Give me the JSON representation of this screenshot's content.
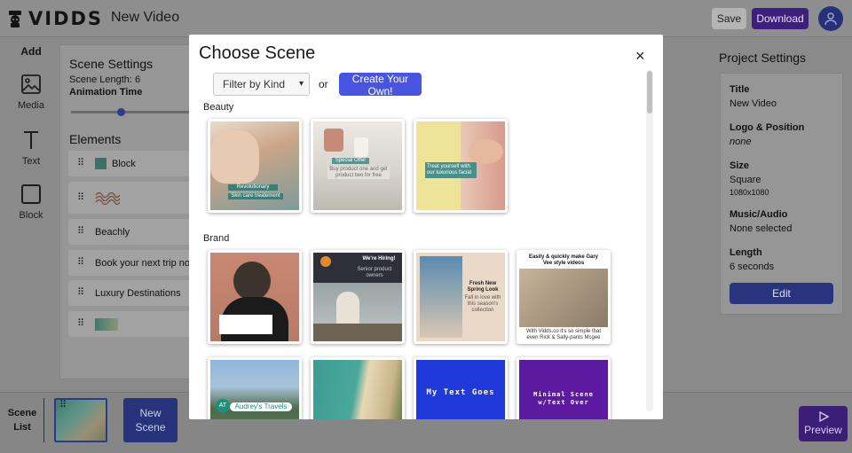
{
  "app": {
    "brand": "VIDDS",
    "document_title": "New Video",
    "save_label": "Save",
    "download_label": "Download"
  },
  "left_tools": {
    "add_label": "Add",
    "items": [
      {
        "label": "Media",
        "icon": "image-icon"
      },
      {
        "label": "Text",
        "icon": "text-t-icon"
      },
      {
        "label": "Block",
        "icon": "square-icon"
      }
    ]
  },
  "scene_settings": {
    "title": "Scene Settings",
    "scene_length": "Scene Length: 6",
    "animation_time": "Animation Time",
    "elements_title": "Elements",
    "elements": [
      {
        "label": "Block",
        "kind": "block"
      },
      {
        "label": "",
        "kind": "squiggle"
      },
      {
        "label": "Beachly",
        "kind": "text"
      },
      {
        "label": "Book your next trip now",
        "kind": "text"
      },
      {
        "label": "Luxury Destinations",
        "kind": "text"
      },
      {
        "label": "",
        "kind": "image"
      }
    ]
  },
  "modal": {
    "title": "Choose Scene",
    "close": "×",
    "filter_placeholder": "Filter by Kind",
    "or_text": "or",
    "create_label": "Create Your Own!",
    "categories": [
      {
        "name": "Beauty",
        "tiles": [
          {
            "caption_1": "Revolutionary",
            "caption_2": "Skin care treatement"
          },
          {
            "caption_1": "Special Offer",
            "caption_2": "Buy product one and get product two for free"
          },
          {
            "caption_1": "Treat yourself with our luxurious facial",
            "caption_2": ""
          }
        ]
      },
      {
        "name": "Brand",
        "tiles": [
          {
            "caption_1": "",
            "caption_2": ""
          },
          {
            "caption_1": "We're Hiring!",
            "caption_2": "Senior product owners"
          },
          {
            "caption_1": "Fresh New Spring Look",
            "caption_2": "Fall in love with this season's collection"
          },
          {
            "caption_1": "Easily & quickly make Gary Vee style videos",
            "caption_2": "With Vidds.co it's so simple that even Rick & Sally-pants Mcgee can do it!"
          }
        ]
      },
      {
        "name": "",
        "tiles": [
          {
            "caption_1": "Audrey's Travels",
            "caption_2": "AT"
          },
          {
            "caption_1": "",
            "caption_2": ""
          },
          {
            "caption_1": "My Text Goes",
            "caption_2": ""
          },
          {
            "caption_1": "Minimal Scene w/Text Over",
            "caption_2": ""
          }
        ]
      }
    ]
  },
  "project_settings": {
    "title": "Project Settings",
    "fields": [
      {
        "key": "Title",
        "value": "New Video"
      },
      {
        "key": "Logo & Position",
        "value": "none"
      },
      {
        "key": "Size",
        "value": "Square",
        "sub": "1080x1080"
      },
      {
        "key": "Music/Audio",
        "value": "None selected"
      },
      {
        "key": "Length",
        "value": "6 seconds"
      }
    ],
    "edit_label": "Edit"
  },
  "bottom": {
    "scene_list_1": "Scene",
    "scene_list_2": "List",
    "new_scene_1": "New",
    "new_scene_2": "Scene",
    "preview_label": "Preview"
  },
  "colors": {
    "overlay_gray": "#8a8a8a",
    "create_button": "#4955e0",
    "download_button": "#3d1f7e",
    "edit_button": "#28347e"
  }
}
